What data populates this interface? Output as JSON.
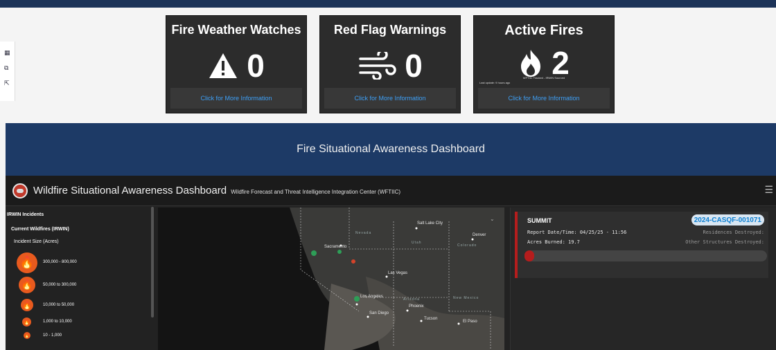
{
  "cards": [
    {
      "title": "Fire Weather Watches",
      "value": "0",
      "icon": "warning-triangle-icon",
      "link": "Click for More Information"
    },
    {
      "title": "Red Flag Warnings",
      "value": "0",
      "icon": "wind-icon",
      "link": "Click for More Information"
    },
    {
      "title": "Active Fires",
      "value": "2",
      "icon": "flame-icon",
      "meta_source": "WFTIIC Tracked - IRWIN Sourced",
      "meta_update": "Last update: 9 hours ago",
      "link": "Click for More Information"
    }
  ],
  "banner": {
    "title": "Fire Situational Awareness Dashboard"
  },
  "app": {
    "title": "Wildfire Situational Awareness Dashboard",
    "subtitle": "Wildfire Forecast and Threat Intelligence Integration Center (WFTIIC)"
  },
  "legend": {
    "header": "IRWIN Incidents",
    "layer": "Current Wildfires (IRWIN)",
    "size_label": "Incident Size (Acres)",
    "items": [
      {
        "label": "300,000 - 800,000"
      },
      {
        "label": "50,000 to 300,000"
      },
      {
        "label": "10,000 to 50,000"
      },
      {
        "label": "1,000 to 10,000"
      },
      {
        "label": "10 - 1,000"
      }
    ]
  },
  "map": {
    "labels": {
      "salt_lake_city": "Salt Lake City",
      "denver": "Denver",
      "sacramento": "Sacramento",
      "las_vegas": "Las Vegas",
      "los_angeles": "Los Angeles",
      "phoenix": "Phoenix",
      "tucson": "Tucson",
      "el_paso": "El Paso",
      "san_diego": "San Diego"
    },
    "states": {
      "nevada": "Nevada",
      "utah": "Utah",
      "colorado": "Colorado",
      "arizona": "Arizona",
      "new_mexico": "New Mexico"
    }
  },
  "incident": {
    "name": "SUMMIT",
    "id": "2024-CASQF-001071",
    "report_line": "Report Date/Time: 04/25/25 - 11:56",
    "acres_line": "Acres Burned: 19.7",
    "residences_label": "Residences Destroyed:",
    "structures_label": "Other Structures Destroyed:",
    "containment_fraction": 0.04
  },
  "colors": {
    "accent_red": "#b51d1d",
    "link_blue": "#3ea0f7",
    "navy": "#1d3a66",
    "fire_orange": "#e85a1e"
  }
}
